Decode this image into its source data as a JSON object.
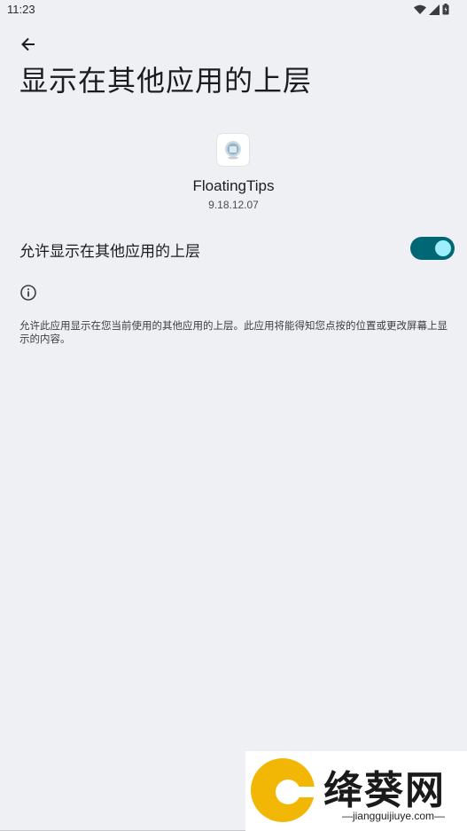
{
  "status_bar": {
    "time": "11:23",
    "icons": [
      "wifi-icon",
      "signal-icon",
      "battery-icon"
    ]
  },
  "header": {
    "back_icon": "arrow-back-icon",
    "title": "显示在其他应用的上层"
  },
  "app": {
    "icon": "floatingtips-app-icon",
    "name": "FloatingTips",
    "version": "9.18.12.07"
  },
  "setting": {
    "label": "允许显示在其他应用的上层",
    "enabled": true
  },
  "info": {
    "icon": "info-icon",
    "description": "允许此应用显示在您当前使用的其他应用的上层。此应用将能得知您点按的位置或更改屏幕上显示的内容。"
  },
  "watermark": {
    "title": "绛葵网",
    "url": "—jiangguijiuye.com—"
  },
  "colors": {
    "background": "#eef0f4",
    "toggle_track": "#006874",
    "toggle_thumb": "#9eeffd"
  }
}
